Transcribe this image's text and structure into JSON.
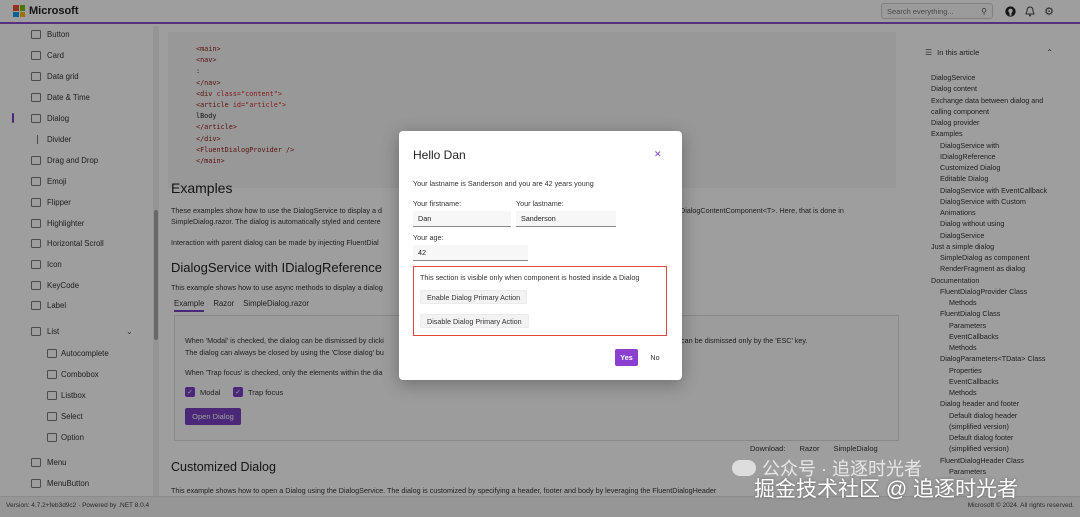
{
  "header": {
    "brand": "Microsoft",
    "search_placeholder": "Search everything...",
    "logo_colors": [
      "#f25022",
      "#7fba00",
      "#00a4ef",
      "#ffb900"
    ]
  },
  "sidebar": {
    "items": [
      {
        "label": "Button"
      },
      {
        "label": "Card"
      },
      {
        "label": "Data grid"
      },
      {
        "label": "Date & Time"
      },
      {
        "label": "Dialog",
        "active": true
      },
      {
        "label": "Divider"
      },
      {
        "label": "Drag and Drop"
      },
      {
        "label": "Emoji"
      },
      {
        "label": "Flipper"
      },
      {
        "label": "Highlighter"
      },
      {
        "label": "Horizontal Scroll"
      },
      {
        "label": "Icon"
      },
      {
        "label": "KeyCode"
      },
      {
        "label": "Label"
      },
      {
        "label": "List",
        "expanded": true
      },
      {
        "label": "Autocomplete",
        "sub": true
      },
      {
        "label": "Combobox",
        "sub": true
      },
      {
        "label": "Listbox",
        "sub": true
      },
      {
        "label": "Select",
        "sub": true
      },
      {
        "label": "Option",
        "sub": true
      },
      {
        "label": "Menu"
      },
      {
        "label": "MenuButton"
      }
    ]
  },
  "main": {
    "code_lines": [
      {
        "tag": "<main>",
        "attr": "",
        "text": ""
      },
      {
        "tag": "<nav>",
        "attr": "",
        "text": ""
      },
      {
        "tag": "",
        "attr": "",
        "text": ":"
      },
      {
        "tag": "</nav>",
        "attr": "",
        "text": ""
      },
      {
        "tag": "<div",
        "attr": " class=\"content\">",
        "text": ""
      },
      {
        "tag": "<article",
        "attr": " id=\"article\">",
        "text": ""
      },
      {
        "tag": "",
        "attr": "",
        "text": "lBody"
      },
      {
        "tag": "</article>",
        "attr": "",
        "text": ""
      },
      {
        "tag": "</div>",
        "attr": "",
        "text": ""
      },
      {
        "tag": "<FluentDialogProvider />",
        "attr": "",
        "text": ""
      },
      {
        "tag": "</main>",
        "attr": "",
        "text": ""
      }
    ],
    "examples_heading": "Examples",
    "examples_text_1": "These examples show how to use the DialogService to display a d",
    "examples_text_1b": "DialogContentComponent<T>. Here, that is done in",
    "examples_text_2": "SimpleDialog.razor. The dialog is automatically styled and centere",
    "examples_text_3": "Interaction with parent dialog can be made by injecting FluentDial",
    "section_heading": "DialogService with IDialogReference",
    "section_text": "This example shows how to use async methods to display a dialog",
    "tabs": [
      "Example",
      "Razor",
      "SimpleDialog.razor"
    ],
    "demo_text_1": "When 'Modal' is checked, the dialog can be dismissed by clicki",
    "demo_text_1b": "can be dismissed only by the 'ESC' key.",
    "demo_text_2": "The dialog can always be closed by using the 'Close dialog' bu",
    "demo_text_3": "When 'Trap focus' is checked, only the elements within the dia",
    "modal_label": "Modal",
    "trap_label": "Trap focus",
    "open_button": "Open Dialog",
    "download_label": "Download:",
    "download_razor": "Razor",
    "download_simple": "SimpleDialog",
    "customized_heading": "Customized Dialog",
    "customized_text": "This example shows how to open a Dialog using the DialogService. The dialog is customized by specifying a header, footer and body by leveraging the FluentDialogHeader"
  },
  "toc": {
    "title": "In this article",
    "items": [
      {
        "label": "DialogService",
        "level": 0
      },
      {
        "label": "Dialog content",
        "level": 0
      },
      {
        "label": "Exchange data between dialog and",
        "level": 0
      },
      {
        "label": "calling component",
        "level": 0
      },
      {
        "label": "Dialog provider",
        "level": 0
      },
      {
        "label": "Examples",
        "level": 0
      },
      {
        "label": "DialogService with",
        "level": 1
      },
      {
        "label": "IDialogReference",
        "level": 1
      },
      {
        "label": "Customized Dialog",
        "level": 1
      },
      {
        "label": "Editable Dialog",
        "level": 1
      },
      {
        "label": "DialogService with EventCallback",
        "level": 1
      },
      {
        "label": "DialogService with Custom",
        "level": 1
      },
      {
        "label": "Animations",
        "level": 1
      },
      {
        "label": "Dialog without using",
        "level": 1
      },
      {
        "label": "DialogService",
        "level": 1
      },
      {
        "label": "Just a simple dialog",
        "level": 0
      },
      {
        "label": "SimpleDialog as component",
        "level": 1
      },
      {
        "label": "RenderFragment as dialog",
        "level": 1
      },
      {
        "label": "Documentation",
        "level": 0
      },
      {
        "label": "FluentDialogProvider Class",
        "level": 1
      },
      {
        "label": "Methods",
        "level": 2
      },
      {
        "label": "FluentDialog Class",
        "level": 1
      },
      {
        "label": "Parameters",
        "level": 2
      },
      {
        "label": "EventCallbacks",
        "level": 2
      },
      {
        "label": "Methods",
        "level": 2
      },
      {
        "label": "DialogParameters<TData> Class",
        "level": 1
      },
      {
        "label": "Properties",
        "level": 2
      },
      {
        "label": "EventCallbacks",
        "level": 2
      },
      {
        "label": "Methods",
        "level": 2
      },
      {
        "label": "Dialog header and footer",
        "level": 1
      },
      {
        "label": "Default dialog header",
        "level": 2
      },
      {
        "label": "(simplified version)",
        "level": 2
      },
      {
        "label": "Default dialog footer",
        "level": 2
      },
      {
        "label": "(simplified version)",
        "level": 2
      },
      {
        "label": "FluentDialogHeader Class",
        "level": 1
      },
      {
        "label": "Parameters",
        "level": 2
      }
    ]
  },
  "dialog": {
    "title": "Hello Dan",
    "message": "Your lastname is Sanderson and you are 42 years young",
    "firstname_label": "Your firstname:",
    "firstname_value": "Dan",
    "lastname_label": "Your lastname:",
    "lastname_value": "Sanderson",
    "age_label": "Your age:",
    "age_value": "42",
    "hosted_text": "This section is visible only when component is hosted inside a Dialog",
    "enable_button": "Enable Dialog Primary Action",
    "disable_button": "Disable Dialog Primary Action",
    "yes_button": "Yes",
    "no_button": "No"
  },
  "status": {
    "left": "Version: 4.7.2+feb3d9c2  ·  Powered by .NET 8.0.4",
    "right": "Microsoft © 2024. All rights reserved."
  },
  "watermark": {
    "line1": "公众号 · 追逐时光者",
    "line2": "掘金技术社区 @ 追逐时光者"
  },
  "colors": {
    "accent": "#7a3fc2",
    "highlight_border": "#e0483e"
  }
}
